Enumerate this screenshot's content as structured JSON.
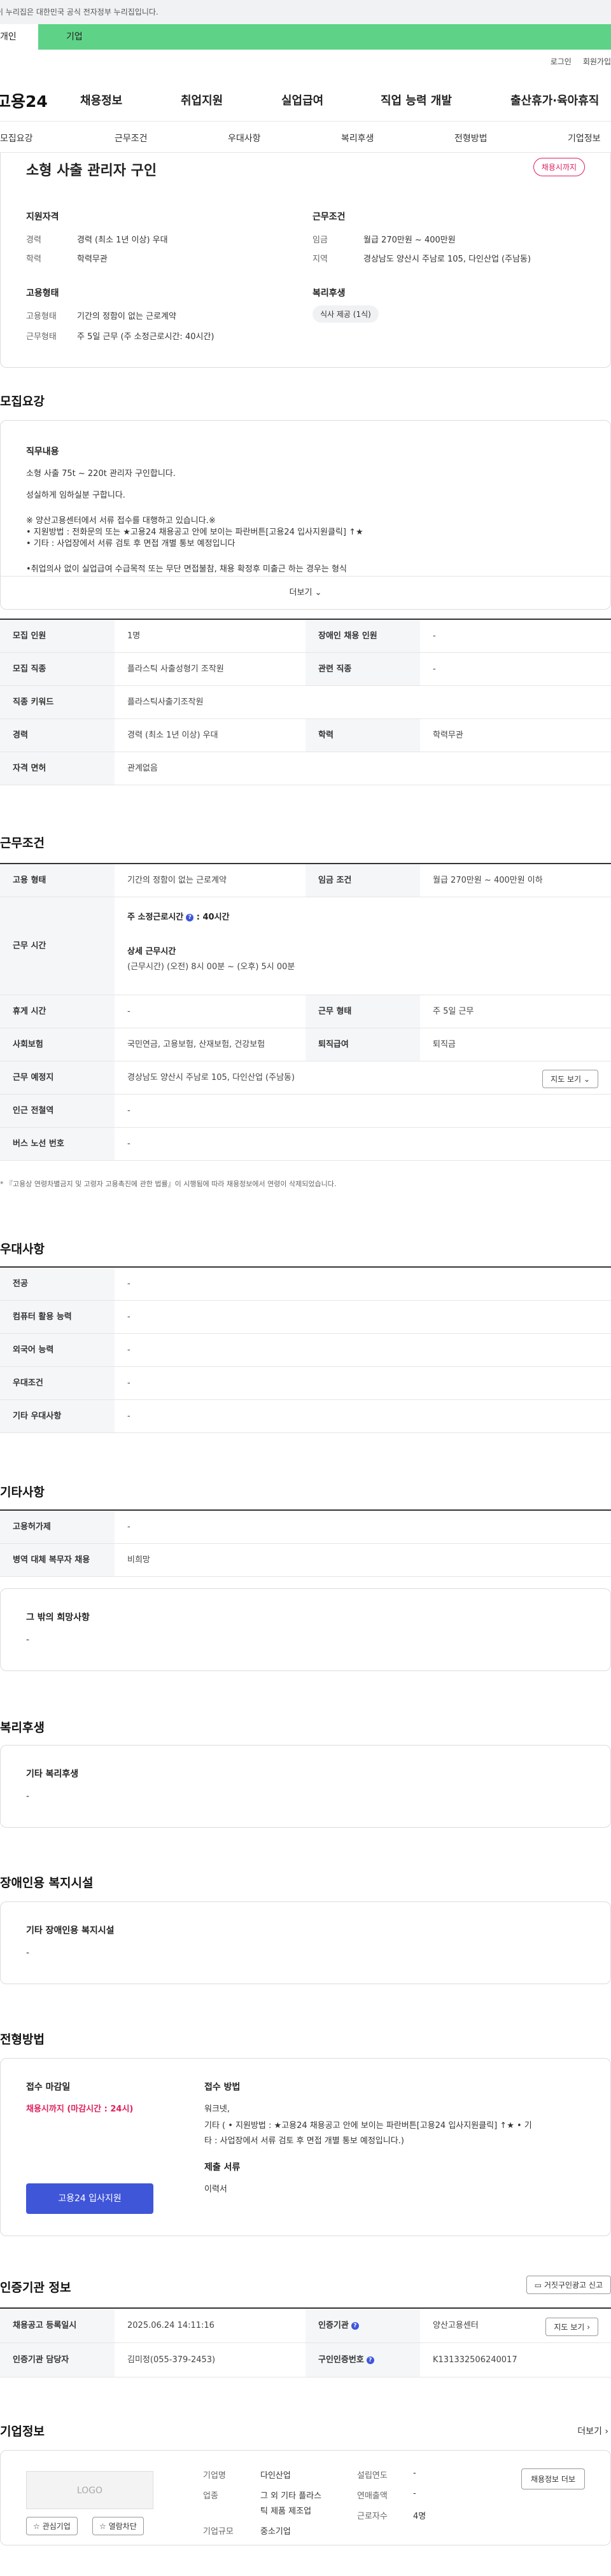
{
  "gov_bar": "이 누리집은 대한민국 공식 전자정부 누리집입니다.",
  "site_tabs": [
    "개인",
    "기업"
  ],
  "util_links": [
    "로그인",
    "회원가입"
  ],
  "logo": "고용24",
  "gnb": [
    "채용정보",
    "취업지원",
    "실업급여",
    "직업 능력 개발",
    "출산휴가·육아휴직"
  ],
  "subnav": [
    "모집요강",
    "근무조건",
    "우대사항",
    "복리후생",
    "전형방법",
    "기업정보"
  ],
  "summary": {
    "title": "소형 사출 관리자 구인",
    "badge": "채용시까지",
    "qual_heading": "지원자격",
    "career_label": "경력",
    "career_value": "경력 (최소 1년 이상) 우대",
    "edu_label": "학력",
    "edu_value": "학력무관",
    "cond_heading": "근무조건",
    "wage_label": "임금",
    "wage_value": "월급 270만원 ~ 400만원",
    "region_label": "지역",
    "region_value": "경상남도 양산시 주남로 105, 다인산업 (주남동)",
    "emp_heading": "고용형태",
    "emp_type_label": "고용형태",
    "emp_type_value": "기간의 정함이 없는 근로계약",
    "work_type_label": "근무형태",
    "work_type_value": "주 5일 근무 (주 소정근로시간: 40시간)",
    "welfare_heading": "복리후생",
    "welfare_chip": "식사 제공 (1식)"
  },
  "recruit": {
    "title": "모집요강",
    "desc_heading": "직무내용",
    "desc_lines": [
      "소형 사출 75t ~ 220t 관리자 구인합니다.",
      "성실하게 임하실분 구합니다.",
      "※ 양산고용센터에서 서류 접수를 대행하고 있습니다.※",
      "• 지원방법 : 전화문의 또는 ★고용24 채용공고 안에 보이는 파란버튼[고용24 입사지원클릭] ↑★",
      "• 기타 : 사업장에서 서류 검토 후 면접 개별 통보 예정입니다",
      "•취업의사 없이 실업급여 수급목적 또는 무단 면접불참, 채용 확정후 미출근 하는 경우는 형식"
    ],
    "more": "더보기",
    "rows": [
      {
        "k1": "모집 인원",
        "v1": "1명",
        "k2": "장애인 채용 인원",
        "v2": "-"
      },
      {
        "k1": "모집 직종",
        "v1": "플라스틱 사출성형기 조작원",
        "k2": "관련 직종",
        "v2": "-"
      },
      {
        "k1": "직종 키워드",
        "v1": "플라스틱사출기조작원",
        "k2": "",
        "v2": ""
      },
      {
        "k1": "경력",
        "v1": "경력 (최소 1년 이상) 우대",
        "k2": "학력",
        "v2": "학력무관"
      },
      {
        "k1": "자격 면허",
        "v1": "관계없음",
        "k2": "",
        "v2": ""
      }
    ]
  },
  "conditions": {
    "title": "근무조건",
    "emp_type_k": "고용 형태",
    "emp_type_v": "기간의 정함이 없는 근로계약",
    "wage_k": "임금 조건",
    "wage_v": "월급 270만원 ~ 400만원 이하",
    "hours_k": "근무 시간",
    "hours_weekly": "주 소정근로시간",
    "hours_weekly_value": ": 40시간",
    "hours_detail_h": "상세 근무시간",
    "hours_detail_v": "(근무시간) (오전) 8시 00분 ~ (오후) 5시 00분",
    "rest_k": "휴게 시간",
    "rest_v": "-",
    "form_k": "근무 형태",
    "form_v": "주 5일 근무",
    "ins_k": "사회보험",
    "ins_v": "국민연금, 고용보험, 산재보험, 건강보험",
    "sev_k": "퇴직급여",
    "sev_v": "퇴직금",
    "place_k": "근무 예정지",
    "place_v": "경상남도 양산시 주남로 105, 다인산업 (주남동)",
    "map_btn": "지도 보기",
    "subway_k": "인근 전철역",
    "subway_v": "-",
    "bus_k": "버스 노선 번호",
    "bus_v": "-",
    "note": "* 『고용상 연령차별금지 및 고령자 고용촉진에 관한 법률』이 시행됨에 따라 채용정보에서 연령이 삭제되었습니다."
  },
  "preferences": {
    "title": "우대사항",
    "rows": [
      {
        "k": "전공",
        "v": "-"
      },
      {
        "k": "컴퓨터 활용 능력",
        "v": "-"
      },
      {
        "k": "외국어 능력",
        "v": "-"
      },
      {
        "k": "우대조건",
        "v": "-"
      },
      {
        "k": "기타 우대사항",
        "v": "-"
      }
    ]
  },
  "etc": {
    "title": "기타사항",
    "rows": [
      {
        "k": "고용허가제",
        "v": "-"
      },
      {
        "k": "병역 대체 복무자 채용",
        "v": "비희망"
      }
    ],
    "other_h": "그 밖의 희망사항",
    "other_v": "-"
  },
  "welfare": {
    "title": "복리후생",
    "h": "기타 복리후생",
    "v": "-"
  },
  "disabled": {
    "title": "장애인용 복지시설",
    "h": "기타 장애인용 복지시설",
    "v": "-"
  },
  "selection": {
    "title": "전형방법",
    "deadline_h": "접수 마감일",
    "deadline_v": "채용시까지 (마감시간 : 24시)",
    "method_h": "접수 방법",
    "method_lines": [
      "워크넷,",
      "기타 ( • 지원방법 : ★고용24 채용공고 안에 보이는 파란버튼[고용24 입사지원클릭] ↑★ • 기",
      "타 : 사업장에서 서류 검토 후 면접 개별 통보 예정입니다.)"
    ],
    "docs_h": "제출 서류",
    "docs_v": "이력서",
    "apply_btn": "고용24 입사지원"
  },
  "agency": {
    "title": "인증기관 정보",
    "report_btn": "거짓구인광고 신고",
    "reg_k": "채용공고 등록일시",
    "reg_v": "2025.06.24 14:11:16",
    "org_k": "인증기관",
    "org_v": "양산고용센터",
    "map_btn": "지도 보기",
    "staff_k": "인증기관 담당자",
    "staff_v": "김미정(055-379-2453)",
    "num_k": "구인인증번호",
    "num_v": "K131332506240017"
  },
  "company": {
    "title": "기업정보",
    "more": "더보기",
    "logo_text": "LOGO",
    "fav_btn": "관심기업",
    "block_btn": "열람차단",
    "name_k": "기업명",
    "name_v": "다인산업",
    "industry_k": "업종",
    "industry_v1": "그 외 기타 플라스",
    "industry_v2": "틱 제품 제조업",
    "size_k": "기업규모",
    "size_v": "중소기업",
    "year_k": "설립연도",
    "year_v": "-",
    "sales_k": "연매출액",
    "sales_v": "-",
    "staff_k": "근로자수",
    "staff_v": "4명",
    "jobs_btn": "채용정보 더보"
  }
}
